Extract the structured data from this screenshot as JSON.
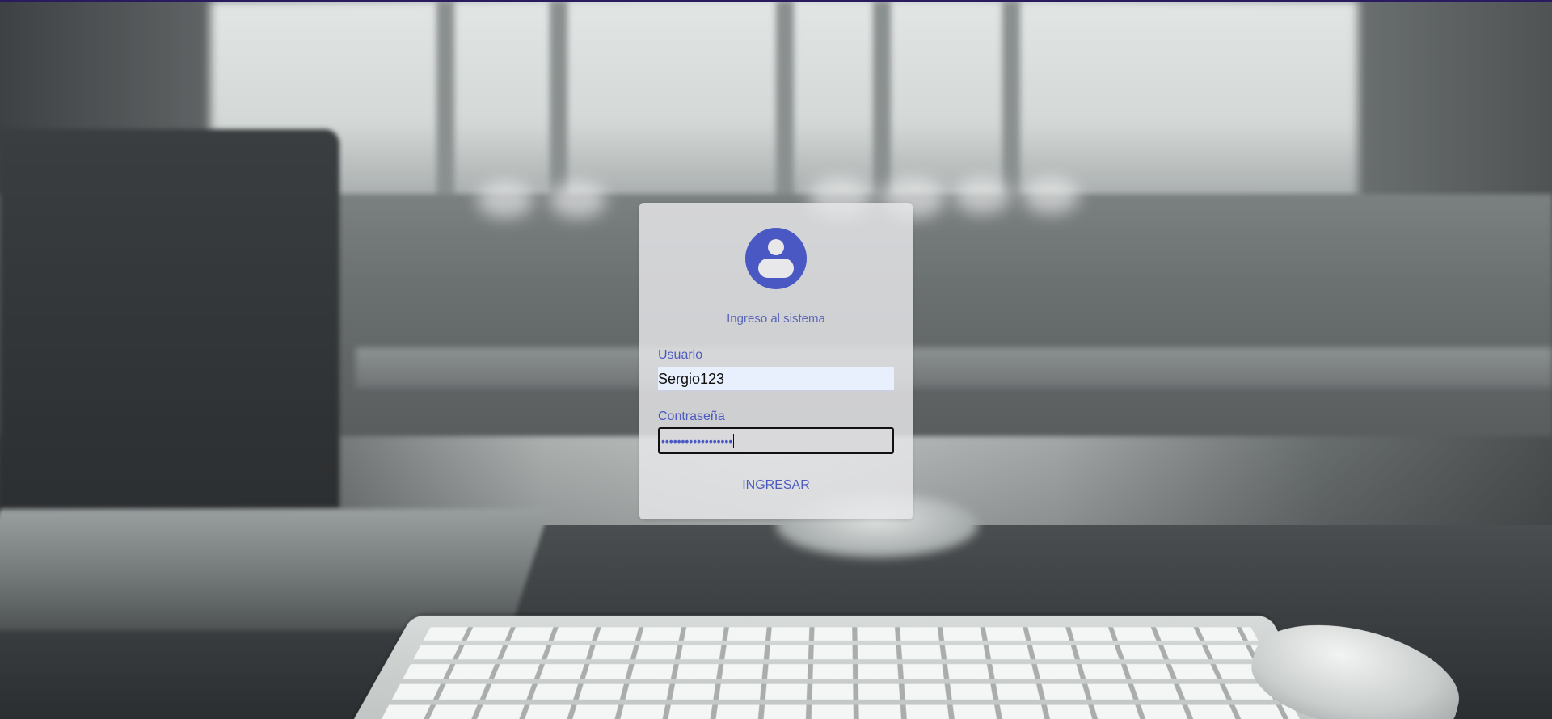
{
  "login": {
    "subtitle": "Ingreso al sistema",
    "username_label": "Usuario",
    "username_value": "Sergio123",
    "password_label": "Contraseña",
    "password_masked": "••••••••••••••••••",
    "submit_label": "INGRESAR"
  },
  "icons": {
    "avatar": "account-circle-icon"
  },
  "colors": {
    "accent": "#4a58c3",
    "top_bar": "#2a1a5e",
    "autofill_background": "#e8f0fe"
  }
}
